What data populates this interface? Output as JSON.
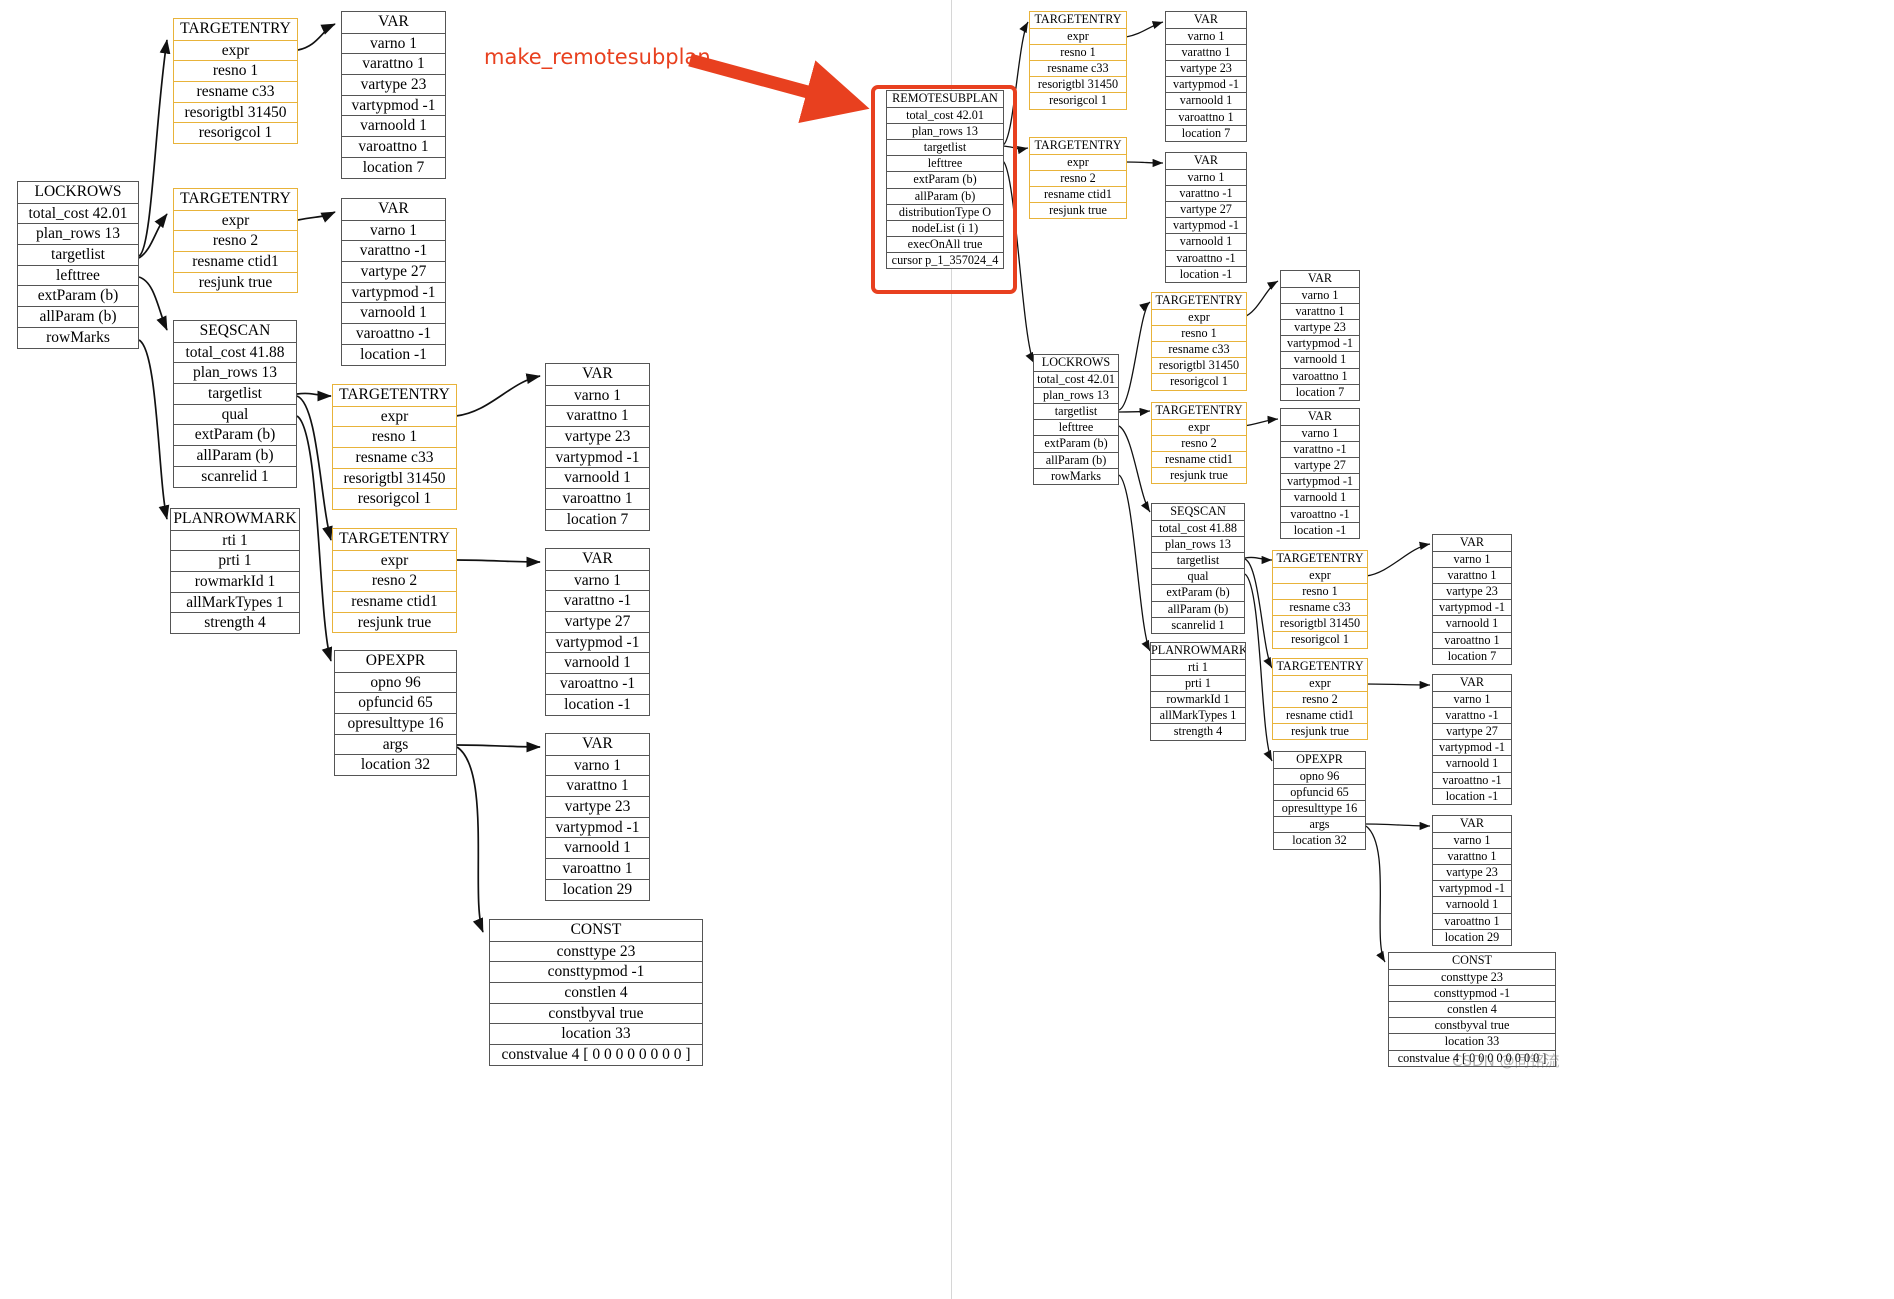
{
  "annotation": {
    "label": "make_remotesubplan"
  },
  "watermark": {
    "text": "CSDN @同铭流"
  },
  "node_titles": {
    "lockrows": "LOCKROWS",
    "seqscan": "SEQSCAN",
    "planrowmark": "PLANROWMARK",
    "targetentry": "TARGETENTRY",
    "var": "VAR",
    "opexpr": "OPEXPR",
    "const": "CONST",
    "remotesubplan": "REMOTESUBPLAN"
  },
  "left_panel": {
    "lockrows": {
      "title": "LOCKROWS",
      "rows": [
        "total_cost 42.01",
        "plan_rows 13",
        "targetlist",
        "lefttree",
        "extParam (b)",
        "allParam (b)",
        "rowMarks"
      ]
    },
    "te1": {
      "title": "TARGETENTRY",
      "rows": [
        "expr",
        "resno 1",
        "resname c33",
        "resorigtbl 31450",
        "resorigcol 1"
      ]
    },
    "var1": {
      "title": "VAR",
      "rows": [
        "varno 1",
        "varattno 1",
        "vartype 23",
        "vartypmod -1",
        "varnoold 1",
        "varoattno 1",
        "location 7"
      ]
    },
    "te2": {
      "title": "TARGETENTRY",
      "rows": [
        "expr",
        "resno 2",
        "resname ctid1",
        "resjunk true"
      ]
    },
    "var2": {
      "title": "VAR",
      "rows": [
        "varno 1",
        "varattno -1",
        "vartype 27",
        "vartypmod -1",
        "varnoold 1",
        "varoattno -1",
        "location -1"
      ]
    },
    "seqscan": {
      "title": "SEQSCAN",
      "rows": [
        "total_cost 41.88",
        "plan_rows 13",
        "targetlist",
        "qual",
        "extParam (b)",
        "allParam (b)",
        "scanrelid 1"
      ]
    },
    "planrowmark": {
      "title": "PLANROWMARK",
      "rows": [
        "rti 1",
        "prti 1",
        "rowmarkId 1",
        "allMarkTypes 1",
        "strength 4"
      ]
    },
    "te3": {
      "title": "TARGETENTRY",
      "rows": [
        "expr",
        "resno 1",
        "resname c33",
        "resorigtbl 31450",
        "resorigcol 1"
      ]
    },
    "var3": {
      "title": "VAR",
      "rows": [
        "varno 1",
        "varattno 1",
        "vartype 23",
        "vartypmod -1",
        "varnoold 1",
        "varoattno 1",
        "location 7"
      ]
    },
    "te4": {
      "title": "TARGETENTRY",
      "rows": [
        "expr",
        "resno 2",
        "resname ctid1",
        "resjunk true"
      ]
    },
    "var4": {
      "title": "VAR",
      "rows": [
        "varno 1",
        "varattno -1",
        "vartype 27",
        "vartypmod -1",
        "varnoold 1",
        "varoattno -1",
        "location -1"
      ]
    },
    "opexpr": {
      "title": "OPEXPR",
      "rows": [
        "opno 96",
        "opfuncid 65",
        "opresulttype 16",
        "args",
        "location 32"
      ]
    },
    "var5": {
      "title": "VAR",
      "rows": [
        "varno 1",
        "varattno 1",
        "vartype 23",
        "vartypmod -1",
        "varnoold 1",
        "varoattno 1",
        "location 29"
      ]
    },
    "const": {
      "title": "CONST",
      "rows": [
        "consttype 23",
        "consttypmod -1",
        "constlen 4",
        "constbyval true",
        "location 33",
        "constvalue 4 [ 0 0 0 0 0 0 0 0 ]"
      ]
    }
  },
  "right_panel": {
    "remotesubplan": {
      "title": "REMOTESUBPLAN",
      "rows": [
        "total_cost 42.01",
        "plan_rows 13",
        "targetlist",
        "lefttree",
        "extParam (b)",
        "allParam (b)",
        "distributionType O",
        "nodeList (i 1)",
        "execOnAll true",
        "cursor p_1_357024_4"
      ]
    },
    "te1": {
      "title": "TARGETENTRY",
      "rows": [
        "expr",
        "resno 1",
        "resname c33",
        "resorigtbl 31450",
        "resorigcol 1"
      ]
    },
    "var1": {
      "title": "VAR",
      "rows": [
        "varno 1",
        "varattno 1",
        "vartype 23",
        "vartypmod -1",
        "varnoold 1",
        "varoattno 1",
        "location 7"
      ]
    },
    "te2": {
      "title": "TARGETENTRY",
      "rows": [
        "expr",
        "resno 2",
        "resname ctid1",
        "resjunk true"
      ]
    },
    "var2": {
      "title": "VAR",
      "rows": [
        "varno 1",
        "varattno -1",
        "vartype 27",
        "vartypmod -1",
        "varnoold 1",
        "varoattno -1",
        "location -1"
      ]
    },
    "lockrows": {
      "title": "LOCKROWS",
      "rows": [
        "total_cost 42.01",
        "plan_rows 13",
        "targetlist",
        "lefttree",
        "extParam (b)",
        "allParam (b)",
        "rowMarks"
      ]
    },
    "te3": {
      "title": "TARGETENTRY",
      "rows": [
        "expr",
        "resno 1",
        "resname c33",
        "resorigtbl 31450",
        "resorigcol 1"
      ]
    },
    "var3": {
      "title": "VAR",
      "rows": [
        "varno 1",
        "varattno 1",
        "vartype 23",
        "vartypmod -1",
        "varnoold 1",
        "varoattno 1",
        "location 7"
      ]
    },
    "te4": {
      "title": "TARGETENTRY",
      "rows": [
        "expr",
        "resno 2",
        "resname ctid1",
        "resjunk true"
      ]
    },
    "var4": {
      "title": "VAR",
      "rows": [
        "varno 1",
        "varattno -1",
        "vartype 27",
        "vartypmod -1",
        "varnoold 1",
        "varoattno -1",
        "location -1"
      ]
    },
    "seqscan": {
      "title": "SEQSCAN",
      "rows": [
        "total_cost 41.88",
        "plan_rows 13",
        "targetlist",
        "qual",
        "extParam (b)",
        "allParam (b)",
        "scanrelid 1"
      ]
    },
    "planrowmark": {
      "title": "PLANROWMARK",
      "rows": [
        "rti 1",
        "prti 1",
        "rowmarkId 1",
        "allMarkTypes 1",
        "strength 4"
      ]
    },
    "te5": {
      "title": "TARGETENTRY",
      "rows": [
        "expr",
        "resno 1",
        "resname c33",
        "resorigtbl 31450",
        "resorigcol 1"
      ]
    },
    "var5": {
      "title": "VAR",
      "rows": [
        "varno 1",
        "varattno 1",
        "vartype 23",
        "vartypmod -1",
        "varnoold 1",
        "varoattno 1",
        "location 7"
      ]
    },
    "te6": {
      "title": "TARGETENTRY",
      "rows": [
        "expr",
        "resno 2",
        "resname ctid1",
        "resjunk true"
      ]
    },
    "var6": {
      "title": "VAR",
      "rows": [
        "varno 1",
        "varattno -1",
        "vartype 27",
        "vartypmod -1",
        "varnoold 1",
        "varoattno -1",
        "location -1"
      ]
    },
    "opexpr": {
      "title": "OPEXPR",
      "rows": [
        "opno 96",
        "opfuncid 65",
        "opresulttype 16",
        "args",
        "location 32"
      ]
    },
    "var7": {
      "title": "VAR",
      "rows": [
        "varno 1",
        "varattno 1",
        "vartype 23",
        "vartypmod -1",
        "varnoold 1",
        "varoattno 1",
        "location 29"
      ]
    },
    "const": {
      "title": "CONST",
      "rows": [
        "consttype 23",
        "consttypmod -1",
        "constlen 4",
        "constbyval true",
        "location 33",
        "constvalue 4 [ 0 0 0 0 0 0 0 0 ]"
      ]
    }
  },
  "colors": {
    "accent_red": "#e8401f",
    "box_border": "#555555",
    "highlight_orange": "#e8b33a",
    "divider": "#d6d6d6"
  }
}
